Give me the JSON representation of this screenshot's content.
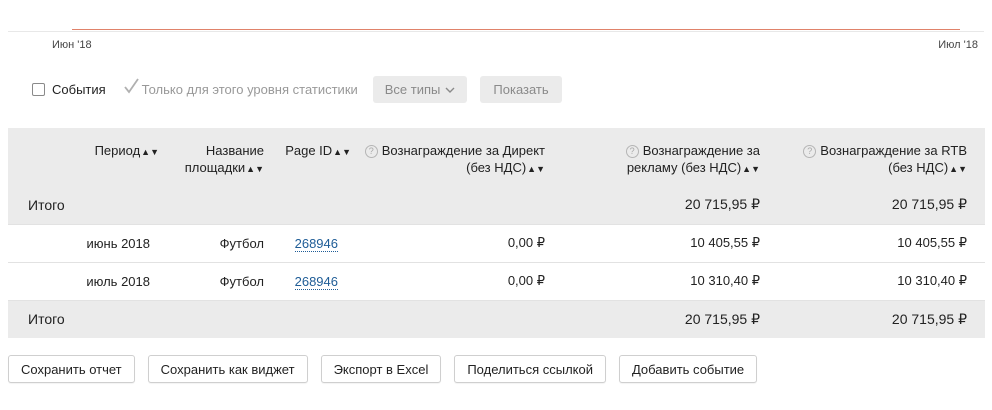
{
  "chart": {
    "x_start_label": "Июн '18",
    "x_end_label": "Июл '18",
    "line_color": "#e0826a"
  },
  "filters": {
    "events_label": "События",
    "level_only_label": "Только для этого уровня статистики",
    "types_button": "Все типы",
    "show_button": "Показать"
  },
  "table": {
    "headers": {
      "period": "Период",
      "site_line1": "Название",
      "site_line2": "площадки",
      "page_id": "Page ID",
      "direct_line1": "Вознаграждение за Директ",
      "direct_line2": "(без НДС)",
      "ads_line1": "Вознаграждение за",
      "ads_line2": "рекламу (без НДС)",
      "rtb_line1": "Вознаграждение за RTB",
      "rtb_line2": "(без НДС)"
    },
    "total_top": {
      "label": "Итого",
      "ads": "20 715,95 ₽",
      "rtb": "20 715,95 ₽"
    },
    "rows": [
      {
        "period": "июнь 2018",
        "site": "Футбол",
        "page_id": "268946",
        "direct": "0,00 ₽",
        "ads": "10 405,55 ₽",
        "rtb": "10 405,55 ₽"
      },
      {
        "period": "июль 2018",
        "site": "Футбол",
        "page_id": "268946",
        "direct": "0,00 ₽",
        "ads": "10 310,40 ₽",
        "rtb": "10 310,40 ₽"
      }
    ],
    "total_bottom": {
      "label": "Итого",
      "ads": "20 715,95 ₽",
      "rtb": "20 715,95 ₽"
    }
  },
  "actions": {
    "save_report": "Сохранить отчет",
    "save_widget": "Сохранить как виджет",
    "export_excel": "Экспорт в Excel",
    "share_link": "Поделиться ссылкой",
    "add_event": "Добавить событие"
  }
}
